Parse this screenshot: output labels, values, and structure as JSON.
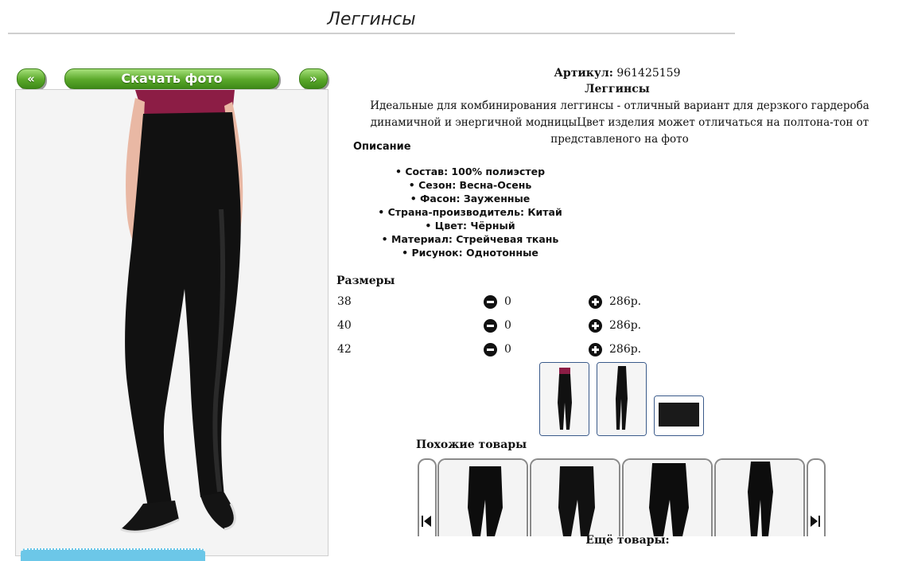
{
  "page": {
    "title": "Леггинсы"
  },
  "gallery": {
    "prev_label": "«",
    "download_label": "Скачать фото",
    "next_label": "»",
    "thumbnails": [
      "thumb-model-front",
      "thumb-model-side",
      "thumb-fabric"
    ]
  },
  "product": {
    "article_label": "Артикул:",
    "article_value": "961425159",
    "name": "Леггинсы",
    "description": "Идеальные для комбинирования леггинсы - отличный вариант для дерзкого гардероба динамичной и энергичной модницыЦвет изделия может отличаться на полтона-тон от представленого на фото",
    "description_heading": "Описание",
    "specs": [
      "Состав: 100% полиэстер",
      "Сезон: Весна-Осень",
      "Фасон: Зауженные",
      "Страна-производитель: Китай",
      "Цвет: Чёрный",
      "Материал: Стрейчевая ткань",
      "Рисунок: Однотонные"
    ]
  },
  "sizes": {
    "heading": "Размеры",
    "rows": [
      {
        "size": "38",
        "qty": "0",
        "price": "286р."
      },
      {
        "size": "40",
        "qty": "0",
        "price": "286р."
      },
      {
        "size": "42",
        "qty": "0",
        "price": "286р."
      }
    ]
  },
  "similar": {
    "heading": "Похожие товары",
    "prev_icon": "skip-prev-icon",
    "next_icon": "skip-next-icon"
  },
  "more": {
    "heading": "Ещё товары:"
  },
  "colors": {
    "button_green": "#5aa82a",
    "thumb_border": "#3a5a8a",
    "link_green": "#0a8a0a",
    "badge_blue": "#6cc7e8"
  }
}
